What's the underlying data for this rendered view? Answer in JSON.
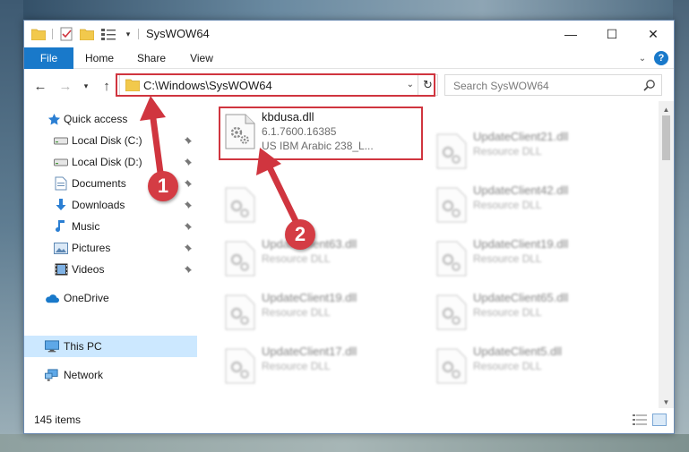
{
  "window": {
    "title": "SysWOW64",
    "minimize": "—",
    "maximize": "☐",
    "close": "✕"
  },
  "ribbon": {
    "tabs": [
      {
        "label": "File"
      },
      {
        "label": "Home"
      },
      {
        "label": "Share"
      },
      {
        "label": "View"
      }
    ],
    "help": "?"
  },
  "navigation": {
    "address": "C:\\Windows\\SysWOW64",
    "search_placeholder": "Search SysWOW64"
  },
  "sidebar": {
    "items": [
      {
        "label": "Quick access",
        "icon": "star-icon"
      },
      {
        "label": "Local Disk (C:)",
        "icon": "drive-icon"
      },
      {
        "label": "Local Disk (D:)",
        "icon": "drive-icon"
      },
      {
        "label": "Documents",
        "icon": "documents-icon"
      },
      {
        "label": "Downloads",
        "icon": "downloads-icon"
      },
      {
        "label": "Music",
        "icon": "music-icon"
      },
      {
        "label": "Pictures",
        "icon": "pictures-icon"
      },
      {
        "label": "Videos",
        "icon": "videos-icon"
      },
      {
        "label": "OneDrive",
        "icon": "onedrive-icon"
      },
      {
        "label": "This PC",
        "icon": "computer-icon",
        "selected": true
      },
      {
        "label": "Network",
        "icon": "network-icon"
      }
    ]
  },
  "files": {
    "highlighted": {
      "name": "kbdusa.dll",
      "version": "6.1.7600.16385",
      "description": "US IBM Arabic 238_L..."
    },
    "left_column": [
      {
        "name": "",
        "type": ""
      },
      {
        "name": "UpdateClient63.dll",
        "type": "Resource DLL"
      },
      {
        "name": "UpdateClient19.dll",
        "type": "Resource DLL"
      },
      {
        "name": "UpdateClient17.dll",
        "type": "Resource DLL"
      }
    ],
    "right_column": [
      {
        "name": "UpdateClient21.dll",
        "type": "Resource DLL"
      },
      {
        "name": "UpdateClient42.dll",
        "type": "Resource DLL"
      },
      {
        "name": "UpdateClient19.dll",
        "type": "Resource DLL"
      },
      {
        "name": "UpdateClient65.dll",
        "type": "Resource DLL"
      },
      {
        "name": "UpdateClient5.dll",
        "type": "Resource DLL"
      }
    ]
  },
  "annotations": {
    "marker_1": "1",
    "marker_2": "2",
    "color": "#d0353f"
  },
  "status": {
    "item_count": "145 items"
  },
  "colors": {
    "accent": "#1979ca",
    "selected_bg": "#cce8ff",
    "folder": "#f2c94c"
  }
}
